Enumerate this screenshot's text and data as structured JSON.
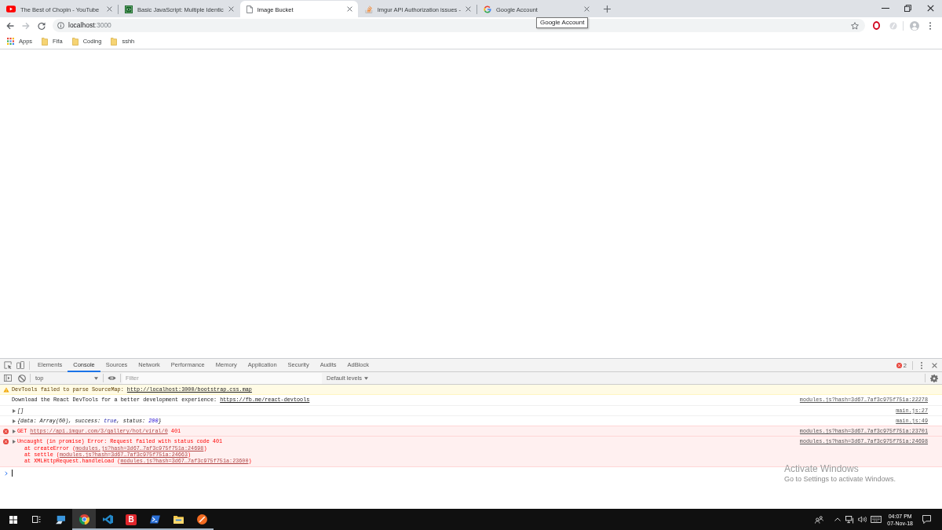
{
  "tabs": [
    {
      "title": "The Best of Chopin - YouTube",
      "kind": "video",
      "selected": false
    },
    {
      "title": "Basic JavaScript: Multiple Identic",
      "kind": "code",
      "selected": false
    },
    {
      "title": "Image Bucket",
      "kind": "page",
      "selected": true
    },
    {
      "title": "Imgur API Authorization issues -",
      "kind": "stack",
      "selected": false
    },
    {
      "title": "Google Account",
      "kind": "g",
      "selected": false
    }
  ],
  "tooltip": "Google Account",
  "toolbar": {
    "back": {
      "disabled": false
    },
    "forward": {
      "disabled": true
    },
    "url_host": "localhost",
    "url_port": ":3000"
  },
  "bookmarks": [
    {
      "label": "Apps",
      "kind": "apps"
    },
    {
      "label": "Fifa",
      "kind": "folder"
    },
    {
      "label": "Coding",
      "kind": "folder"
    },
    {
      "label": "sshh",
      "kind": "folder"
    }
  ],
  "devtools": {
    "tabs": [
      {
        "label": "Elements",
        "selected": false
      },
      {
        "label": "Console",
        "selected": true
      },
      {
        "label": "Sources",
        "selected": false
      },
      {
        "label": "Network",
        "selected": false
      },
      {
        "label": "Performance",
        "selected": false
      },
      {
        "label": "Memory",
        "selected": false
      },
      {
        "label": "Application",
        "selected": false
      },
      {
        "label": "Security",
        "selected": false
      },
      {
        "label": "Audits",
        "selected": false
      },
      {
        "label": "AdBlock",
        "selected": false
      }
    ],
    "error_count": "2",
    "context": "top",
    "filter": {
      "placeholder": "Filter"
    },
    "levels": "Default levels",
    "messages": [
      {
        "kind": "warning",
        "parts": [
          {
            "kind": "text",
            "text": "DevTools failed to parse SourceMap: "
          },
          {
            "kind": "link",
            "text": "http://localhost:3000/bootstrap.css.map"
          }
        ]
      },
      {
        "kind": "info",
        "parts": [
          {
            "kind": "text",
            "text": "Download the React DevTools for a better development experience: "
          },
          {
            "kind": "link",
            "text": "https://fb.me/react-devtools"
          }
        ],
        "source": "modules.js?hash=3d67…7af3c975f751a:22278"
      },
      {
        "kind": "object",
        "parts": [
          {
            "kind": "text",
            "text": "[]"
          }
        ],
        "source": "main.js:27"
      },
      {
        "kind": "object",
        "parts": [
          {
            "kind": "text",
            "text": "{data: Array(60), success: "
          },
          {
            "kind": "keyword",
            "text": "true"
          },
          {
            "kind": "text",
            "text": ", status: "
          },
          {
            "kind": "number",
            "text": "200"
          },
          {
            "kind": "text",
            "text": "}"
          }
        ],
        "source": "main.js:49"
      },
      {
        "kind": "error",
        "parts": [
          {
            "kind": "text",
            "text": "GET "
          },
          {
            "kind": "link",
            "text": "https://api.imgur.com/3/gallery/hot/viral/0"
          },
          {
            "kind": "text",
            "text": " 401"
          }
        ],
        "source": "modules.js?hash=3d67…7af3c975f751a:23701"
      },
      {
        "kind": "error",
        "parts": [
          {
            "kind": "text",
            "text": "Uncaught (in promise) Error: Request failed with status code 401"
          }
        ],
        "source": "modules.js?hash=3d67…7af3c975f751a:24698",
        "stack": [
          {
            "parts": [
              {
                "kind": "text",
                "text": "at createError ("
              },
              {
                "kind": "link",
                "text": "modules.js?hash=3d67…7af3c975f751a:24698"
              },
              {
                "kind": "text",
                "text": ")"
              }
            ]
          },
          {
            "parts": [
              {
                "kind": "text",
                "text": "at settle ("
              },
              {
                "kind": "link",
                "text": "modules.js?hash=3d67…7af3c975f751a:24663"
              },
              {
                "kind": "text",
                "text": ")"
              }
            ]
          },
          {
            "parts": [
              {
                "kind": "text",
                "text": "at XMLHttpRequest.handleLoad ("
              },
              {
                "kind": "link",
                "text": "modules.js?hash=3d67…7af3c975f751a:23600"
              },
              {
                "kind": "text",
                "text": ")"
              }
            ]
          }
        ]
      }
    ]
  },
  "activation_notice": {
    "title": "Activate Windows",
    "subtitle": "Go to Settings to activate Windows."
  },
  "taskbar": {
    "apps": [
      {
        "kind": "desktop",
        "running": false,
        "selected": false
      },
      {
        "kind": "browser",
        "running": true,
        "selected": true
      },
      {
        "kind": "editor",
        "running": true,
        "selected": false
      },
      {
        "kind": "letter",
        "label": "B",
        "running": true,
        "selected": false
      },
      {
        "kind": "shell",
        "running": true,
        "selected": false
      },
      {
        "kind": "folder",
        "running": true,
        "selected": false
      },
      {
        "kind": "orange",
        "running": true,
        "selected": false
      }
    ],
    "clock": {
      "time": "04:07 PM",
      "date": "07-Nov-18"
    }
  }
}
